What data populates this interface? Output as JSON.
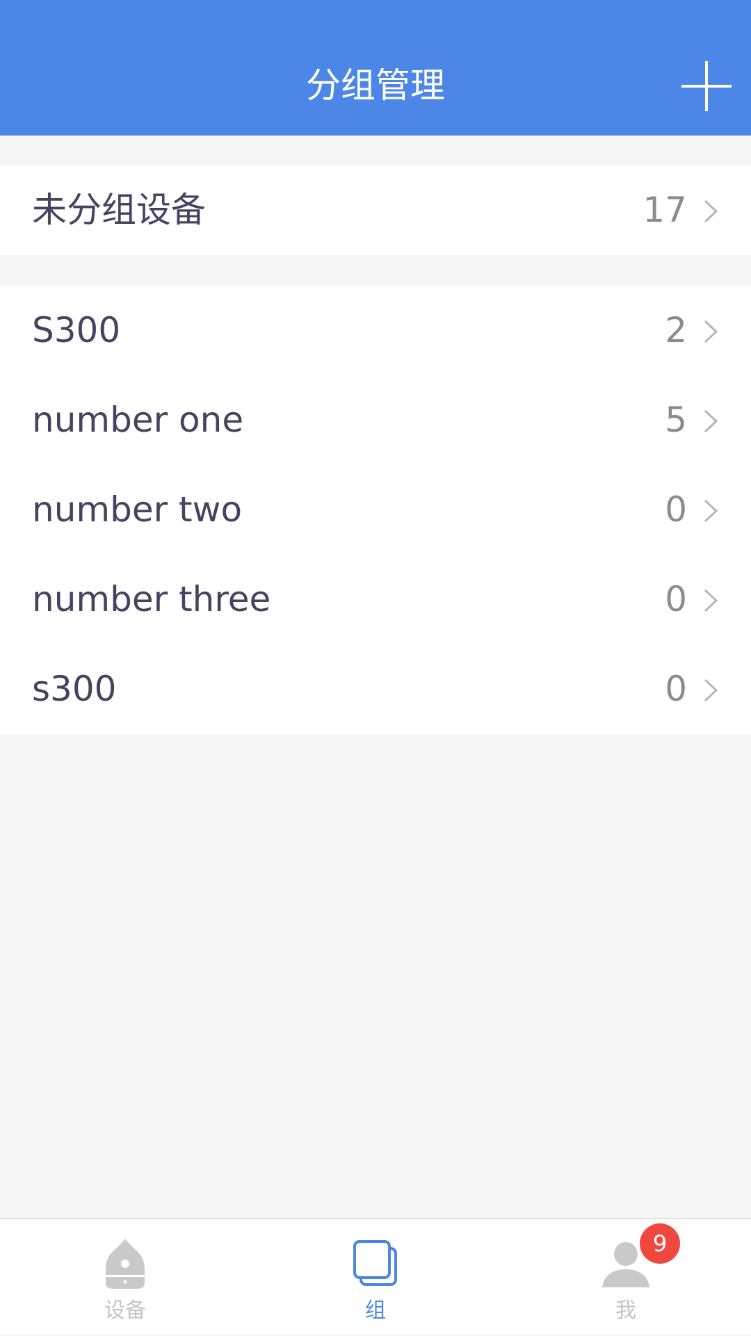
{
  "header": {
    "title": "分组管理",
    "add_icon": "plus-icon"
  },
  "ungrouped": {
    "name": "未分组设备",
    "count": "17"
  },
  "groups": [
    {
      "name": "S300",
      "count": "2"
    },
    {
      "name": "number one",
      "count": "5"
    },
    {
      "name": "number two",
      "count": "0"
    },
    {
      "name": "number three",
      "count": "0"
    },
    {
      "name": "s300",
      "count": "0"
    }
  ],
  "tabs": [
    {
      "label": "设备",
      "icon": "device-icon",
      "active": false
    },
    {
      "label": "组",
      "icon": "group-icon",
      "active": true
    },
    {
      "label": "我",
      "icon": "user-icon",
      "active": false
    }
  ],
  "profile_badge": "9",
  "colors": {
    "accent": "#4c86e6",
    "badge": "#f0473f",
    "inactive": "#c4c4c4"
  }
}
